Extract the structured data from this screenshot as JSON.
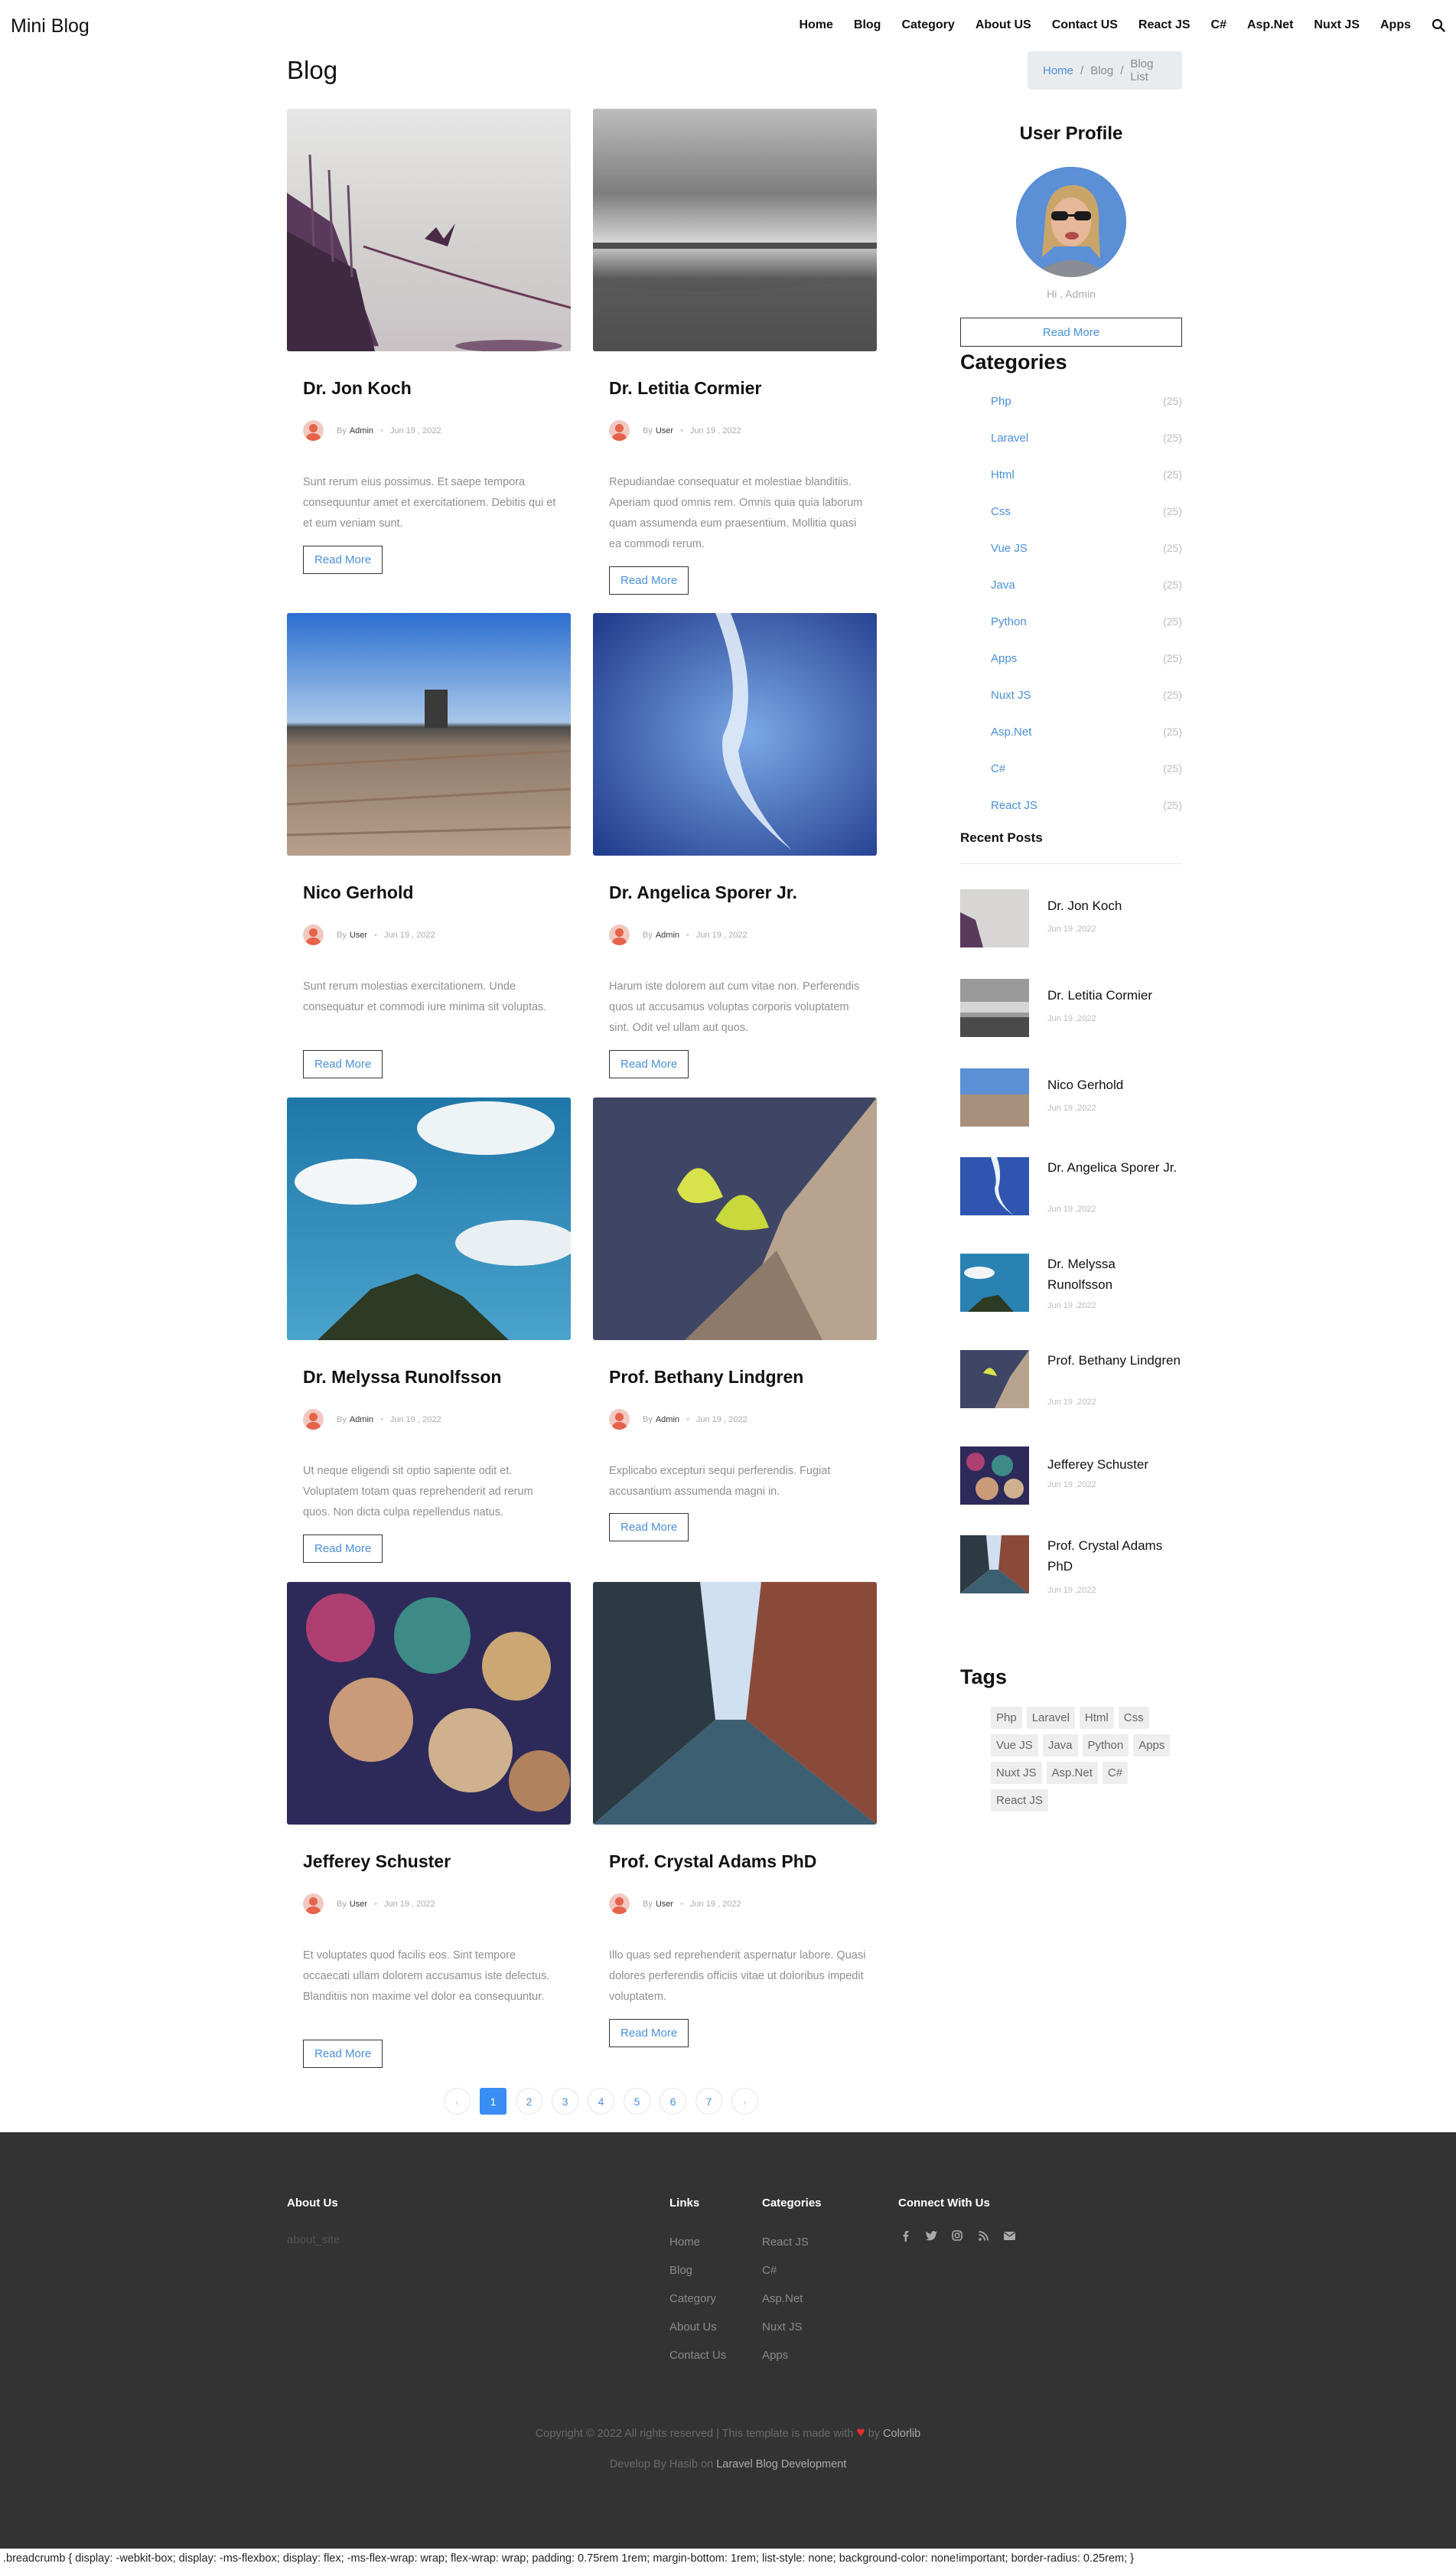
{
  "brand": "Mini Blog",
  "nav": [
    "Home",
    "Blog",
    "Category",
    "About US",
    "Contact US",
    "React JS",
    "C#",
    "Asp.Net",
    "Nuxt JS",
    "Apps"
  ],
  "page_title": "Blog",
  "breadcrumb": {
    "home": "Home",
    "sep": "/",
    "blog": "Blog",
    "current": "Blog List"
  },
  "read_more": "Read More",
  "by": "By",
  "posts": [
    {
      "title": "Dr. Jon Koch",
      "author": "Admin",
      "date": "Jun 19 , 2022",
      "excerpt": "Sunt rerum eius possimus. Et saepe tempora consequuntur amet et exercitationem. Debitis qui et et eum veniam sunt."
    },
    {
      "title": "Dr. Letitia Cormier",
      "author": "User",
      "date": "Jun 19 , 2022",
      "excerpt": "Repudiandae consequatur et molestiae blanditiis. Aperiam quod omnis rem. Omnis quia quia laborum quam assumenda eum praesentium. Mollitia quasi ea commodi rerum."
    },
    {
      "title": "Nico Gerhold",
      "author": "User",
      "date": "Jun 19 , 2022",
      "excerpt": "Sunt rerum molestias exercitationem. Unde consequatur et commodi iure minima sit voluptas."
    },
    {
      "title": "Dr. Angelica Sporer Jr.",
      "author": "Admin",
      "date": "Jun 19 , 2022",
      "excerpt": "Harum iste dolorem aut cum vitae non. Perferendis quos ut accusamus voluptas corporis voluptatem sint. Odit vel ullam aut quos."
    },
    {
      "title": "Dr. Melyssa Runolfsson",
      "author": "Admin",
      "date": "Jun 19 , 2022",
      "excerpt": "Ut neque eligendi sit optio sapiente odit et. Voluptatem totam quas reprehenderit ad rerum quos. Non dicta culpa repellendus natus."
    },
    {
      "title": "Prof. Bethany Lindgren",
      "author": "Admin",
      "date": "Jun 19 , 2022",
      "excerpt": "Explicabo excepturi sequi perferendis. Fugiat accusantium assumenda magni in."
    },
    {
      "title": "Jefferey Schuster",
      "author": "User",
      "date": "Jun 19 , 2022",
      "excerpt": "Et voluptates quod facilis eos. Sint tempore occaecati ullam dolorem accusamus iste delectus. Blanditiis non maxime vel dolor ea consequuntur."
    },
    {
      "title": "Prof. Crystal Adams PhD",
      "author": "User",
      "date": "Jun 19 , 2022",
      "excerpt": "Illo quas sed reprehenderit aspernatur labore. Quasi dolores perferendis officiis vitae ut doloribus impedit voluptatem."
    }
  ],
  "pagination": [
    "‹",
    "1",
    "2",
    "3",
    "4",
    "5",
    "6",
    "7",
    "›"
  ],
  "sidebar": {
    "profile_title": "User Profile",
    "greeting": "Hi , Admin",
    "categories_title": "Categories",
    "categories": [
      {
        "name": "Php",
        "count": "(25)"
      },
      {
        "name": "Laravel",
        "count": "(25)"
      },
      {
        "name": "Html",
        "count": "(25)"
      },
      {
        "name": "Css",
        "count": "(25)"
      },
      {
        "name": "Vue JS",
        "count": "(25)"
      },
      {
        "name": "Java",
        "count": "(25)"
      },
      {
        "name": "Python",
        "count": "(25)"
      },
      {
        "name": "Apps",
        "count": "(25)"
      },
      {
        "name": "Nuxt JS",
        "count": "(25)"
      },
      {
        "name": "Asp.Net",
        "count": "(25)"
      },
      {
        "name": "C#",
        "count": "(25)"
      },
      {
        "name": "React JS",
        "count": "(25)"
      }
    ],
    "recent_title": "Recent Posts",
    "recent": [
      {
        "title": "Dr. Jon Koch",
        "date": "Jun 19 ,2022"
      },
      {
        "title": "Dr. Letitia Cormier",
        "date": "Jun 19 ,2022"
      },
      {
        "title": "Nico Gerhold",
        "date": "Jun 19 ,2022"
      },
      {
        "title": "Dr. Angelica Sporer Jr.",
        "date": "Jun 19 ,2022"
      },
      {
        "title": "Dr. Melyssa Runolfsson",
        "date": "Jun 19 ,2022"
      },
      {
        "title": "Prof. Bethany Lindgren",
        "date": "Jun 19 ,2022"
      },
      {
        "title": "Jefferey Schuster",
        "date": "Jun 19 ,2022"
      },
      {
        "title": "Prof. Crystal Adams PhD",
        "date": "Jun 19 ,2022"
      }
    ],
    "tags_title": "Tags",
    "tags": [
      "Php",
      "Laravel",
      "Html",
      "Css",
      "Vue JS",
      "Java",
      "Python",
      "Apps",
      "Nuxt JS",
      "Asp.Net",
      "C#",
      "React JS"
    ]
  },
  "footer": {
    "about_title": "About Us",
    "about_text": "about_site",
    "links_title": "Links",
    "links": [
      "Home",
      "Blog",
      "Category",
      "About Us",
      "Contact Us"
    ],
    "categories_title": "Categories",
    "categories": [
      "React JS",
      "C#",
      "Asp.Net",
      "Nuxt JS",
      "Apps"
    ],
    "connect_title": "Connect With Us",
    "social_icons": [
      "facebook-icon",
      "twitter-icon",
      "instagram-icon",
      "rss-icon",
      "envelope-icon"
    ],
    "copyright_prefix": "Copyright © 2022 All rights reserved | This template is made with",
    "copyright_by": "by",
    "copyright_link": "Colorlib",
    "dev_prefix": "Develop By Hasib on",
    "dev_link": "Laravel Blog Development"
  },
  "css_leak_text": ".breadcrumb { display: -webkit-box; display: -ms-flexbox; display: flex; -ms-flex-wrap: wrap; flex-wrap: wrap; padding: 0.75rem 1rem; margin-bottom: 1rem; list-style: none; background-color: none!important; border-radius: 0.25rem; }",
  "colors": {
    "accent": "#4a90d9",
    "active_page": "#3a8df5",
    "footer_bg": "#333333",
    "heart": "#e32c2c"
  }
}
